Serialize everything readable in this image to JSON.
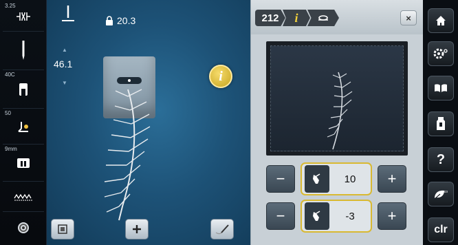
{
  "left_bar": {
    "items": [
      {
        "label": "3.25",
        "icon": "stitch-width-icon"
      },
      {
        "label": "",
        "icon": "needle-icon"
      },
      {
        "label": "40C",
        "icon": "presser-foot-icon"
      },
      {
        "label": "50",
        "icon": "presser-pressure-icon"
      },
      {
        "label": "9mm",
        "icon": "stitch-plate-icon"
      },
      {
        "label": "",
        "icon": "stitch-pattern-icon"
      },
      {
        "label": "",
        "icon": "bobbin-icon"
      }
    ]
  },
  "center": {
    "lock_value": "20.3",
    "stitch_length": "46.1",
    "buttons": [
      "layout-icon",
      "plus-icon",
      "needle-thread-icon"
    ]
  },
  "info_panel": {
    "breadcrumb": [
      "212",
      "i",
      "presser-foot-sole-icon"
    ],
    "rows": [
      {
        "minus": "−",
        "value": "10",
        "plus": "+"
      },
      {
        "minus": "−",
        "value": "-3",
        "plus": "+"
      }
    ],
    "close": "×"
  },
  "right_bar": {
    "items": [
      "home-icon",
      "settings-icon",
      "tutorial-book-icon",
      "creative-consultant-icon",
      "help-icon",
      "eco-icon",
      "clr"
    ]
  },
  "colors": {
    "accent": "#d9b931",
    "background": "#1d5277"
  }
}
